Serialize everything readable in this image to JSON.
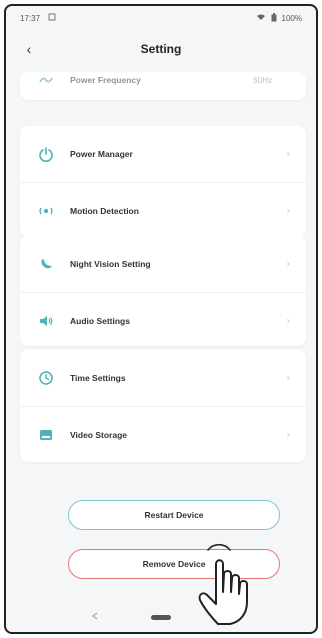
{
  "status_bar": {
    "time": "17:37",
    "battery": "100%"
  },
  "header": {
    "title": "Setting",
    "back_glyph": "‹"
  },
  "partial_row": {
    "label": "Power Frequency",
    "value": "50Hz"
  },
  "groups": [
    {
      "items": [
        {
          "label": "Power Manager",
          "icon": "power-icon"
        },
        {
          "label": "Motion Detection",
          "icon": "motion-detection-icon"
        }
      ]
    },
    {
      "items": [
        {
          "label": "Night Vision Setting",
          "icon": "night-vision-icon"
        },
        {
          "label": "Audio Settings",
          "icon": "speaker-icon"
        }
      ]
    },
    {
      "items": [
        {
          "label": "Time Settings",
          "icon": "clock-icon"
        },
        {
          "label": "Video Storage",
          "icon": "storage-icon"
        }
      ]
    }
  ],
  "buttons": {
    "restart": "Restart Device",
    "remove": "Remove Device"
  },
  "colors": {
    "accent": "#4fb3b9",
    "danger": "#e07a70",
    "background": "#f4f6f8"
  },
  "chevron_glyph": "›"
}
